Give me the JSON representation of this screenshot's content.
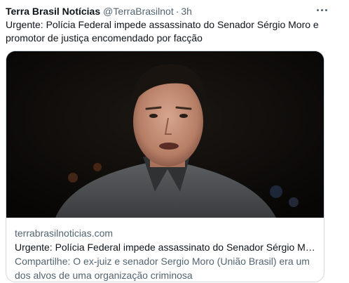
{
  "tweet": {
    "author_name": "Terra Brasil Notícias",
    "author_handle": "@TerraBrasilnot",
    "separator": "·",
    "timestamp": "3h",
    "text": "Urgente: Polícia Federal impede assassinato do Senador Sérgio Moro e promotor de justiça encomendado por facção"
  },
  "card": {
    "domain": "terrabrasilnoticias.com",
    "title": "Urgente: Polícia Federal impede assassinato do Senador Sérgio Moro e...",
    "description": "Compartilhe: O ex-juiz e senador Sergio Moro (União Brasil) era um dos alvos de uma organização criminosa"
  },
  "icons": {
    "more": "more-horizontal-icon"
  },
  "colors": {
    "text_primary": "#0f1419",
    "text_secondary": "#536471",
    "card_border": "#cfd9de",
    "media_background": "#0e0c0b"
  }
}
